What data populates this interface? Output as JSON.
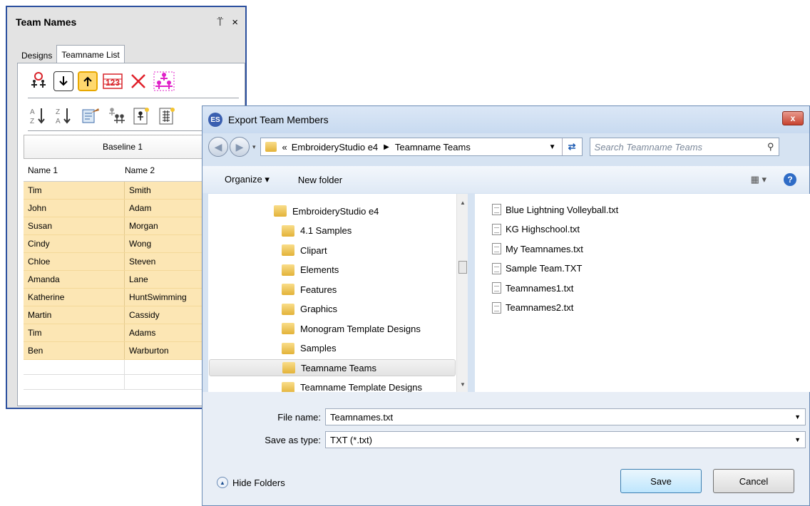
{
  "team_panel": {
    "title": "Team Names",
    "pin_glyph": "⍡",
    "close_glyph": "×",
    "tabs": [
      "Designs",
      "Teamname List"
    ],
    "baseline_header": "Baseline 1",
    "columns": [
      "Name 1",
      "Name 2"
    ],
    "rows": [
      [
        "Tim",
        "Smith"
      ],
      [
        "John",
        "Adam"
      ],
      [
        "Susan",
        "Morgan"
      ],
      [
        "Cindy",
        "Wong"
      ],
      [
        "Chloe",
        "Steven"
      ],
      [
        "Amanda",
        "Lane"
      ],
      [
        "Katherine",
        "HuntSwimming"
      ],
      [
        "Martin",
        "Cassidy"
      ],
      [
        "Tim",
        "Adams"
      ],
      [
        "Ben",
        "Warburton"
      ]
    ],
    "icon_123": "123"
  },
  "dialog": {
    "title": "Export Team Members",
    "close_glyph": "x",
    "address": {
      "prefix": "«",
      "crumbs": [
        "EmbroideryStudio e4",
        "Teamname Teams"
      ]
    },
    "search_placeholder": "Search Teamname Teams",
    "toolbar": {
      "organize": "Organize ▾",
      "new_folder": "New folder"
    },
    "tree": [
      "EmbroideryStudio e4",
      "4.1 Samples",
      "Clipart",
      "Elements",
      "Features",
      "Graphics",
      "Monogram Template Designs",
      "Samples",
      "Teamname Teams",
      "Teamname Template Designs"
    ],
    "selected_folder": "Teamname Teams",
    "files": [
      "Blue Lightning Volleyball.txt",
      "KG Highschool.txt",
      "My Teamnames.txt",
      "Sample Team.TXT",
      "Teamnames1.txt",
      "Teamnames2.txt"
    ],
    "file_name_label": "File name:",
    "file_name_value": "Teamnames.txt",
    "save_type_label": "Save as type:",
    "save_type_value": "TXT (*.txt)",
    "hide_folders": "Hide Folders",
    "save_label": "Save",
    "cancel_label": "Cancel",
    "help_glyph": "?"
  },
  "colors": {
    "row_highlight": "#fce6b4",
    "panel_border": "#2b4f9e",
    "dialog_bg": "#d6e3f2"
  }
}
